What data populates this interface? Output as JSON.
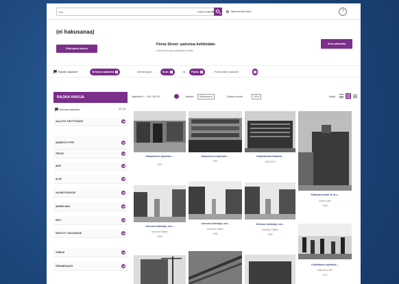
{
  "header": {
    "search_placeholder": "Hae...",
    "search_scope": "Kaikki sisältö",
    "advanced_search": "Tarkennettu haku",
    "help": "?"
  },
  "page": {
    "heading": "(ei hakusanaa)",
    "save_search": "Pidä hakusi talteen",
    "promo_title": "Finna Street -palvelua kehitetään",
    "promo_subtitle": "Voit kertoa myös palautteesi meille",
    "feedback_button": "Anna palautetta"
  },
  "filters": {
    "keep_filters": "Säilytä rajaukset",
    "online_pill": "Verkossa saatavilla",
    "format_label": "Aineistotyyppi:",
    "format_pill": "Kuva",
    "and": "tai",
    "format_pill_2": "Paikka",
    "remove_all": "Poista kaikki rajaukset"
  },
  "sidebar": {
    "header": "RAJAA HAKUA",
    "only_online": "Verkossa saatavilla",
    "only_online_count": "59 131",
    "facets": [
      "SALLITUT KÄYTTÖTAVAT",
      "AINEISTOTYYPPI",
      "TEKIJÄ",
      "AIHE",
      "ALUE",
      "VALMISTUSVUOSI",
      "AIHEEN AIKA",
      "KIELI",
      "SISÄLTYY JULKAISUUN",
      "TOIMIJA",
      "ORGANISAATIO"
    ]
  },
  "toolbar": {
    "results": "Näytetään 1 - 100 / 59 131",
    "sort_label": "Järjestä",
    "sort_value": "Relevanssi",
    "per_page_label": "Tuloksia sivulla",
    "per_page_value": "100",
    "view_label": "Näytä"
  },
  "results": [
    {
      "title": "Hakaniemen Apteekki ...",
      "author": "",
      "year": "1987"
    },
    {
      "title": "Hakaniemen Apteekki ...",
      "author": "",
      "year": "1987"
    },
    {
      "title": "Katurakennä Hakanie...",
      "author": "",
      "year": "1968-1970"
    },
    {
      "title": "Siltasaarenkatu 11 Are...",
      "author": "Alvaas Kalle",
      "year": "1935"
    },
    {
      "title": "Jehovan todistaja, insi...",
      "author": "Kanninen Viljemi",
      "year": "1945"
    },
    {
      "title": "Jehovan todistaja, insi...",
      "author": "Kanninen Viljemi",
      "year": "1945"
    },
    {
      "title": "Jehovan todistaja, insi...",
      "author": "Kanninen Viljemi",
      "year": "1945"
    },
    {
      "title": "Kallioiainen päivänsk...",
      "author": "Moisi Eeva 309",
      "year": "1970"
    },
    {
      "title": "",
      "author": "",
      "year": ""
    },
    {
      "title": "",
      "author": "",
      "year": ""
    },
    {
      "title": "",
      "author": "",
      "year": ""
    }
  ],
  "colors": {
    "accent": "#7b2e8a",
    "link": "#3b4b8a",
    "background": "#1f4e86"
  }
}
